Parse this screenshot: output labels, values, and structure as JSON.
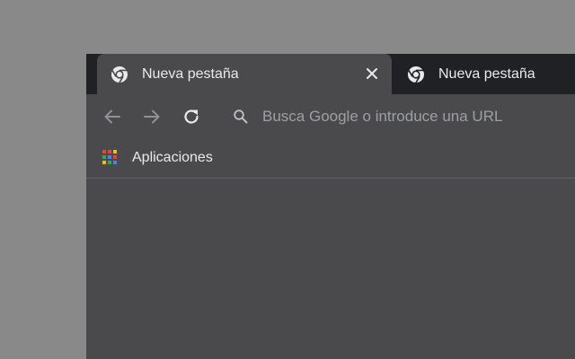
{
  "tabs": [
    {
      "title": "Nueva pestaña",
      "icon": "chrome-icon",
      "active": true,
      "close_icon": "close-icon"
    },
    {
      "title": "Nueva pestaña",
      "icon": "chrome-icon",
      "active": false
    }
  ],
  "toolbar": {
    "back_icon": "back-arrow-icon",
    "forward_icon": "forward-arrow-icon",
    "reload_icon": "reload-icon"
  },
  "omnibox": {
    "icon": "search-icon",
    "placeholder": "Busca Google o introduce una URL",
    "value": ""
  },
  "bookmarks": {
    "items": [
      {
        "label": "Aplicaciones",
        "icon": "apps-grid-icon"
      }
    ]
  },
  "colors": {
    "desktop": "#898989",
    "tabstrip": "#202124",
    "toolbar": "#4a4a4c",
    "text": "#e8eaed",
    "muted": "#9aa0a6"
  }
}
